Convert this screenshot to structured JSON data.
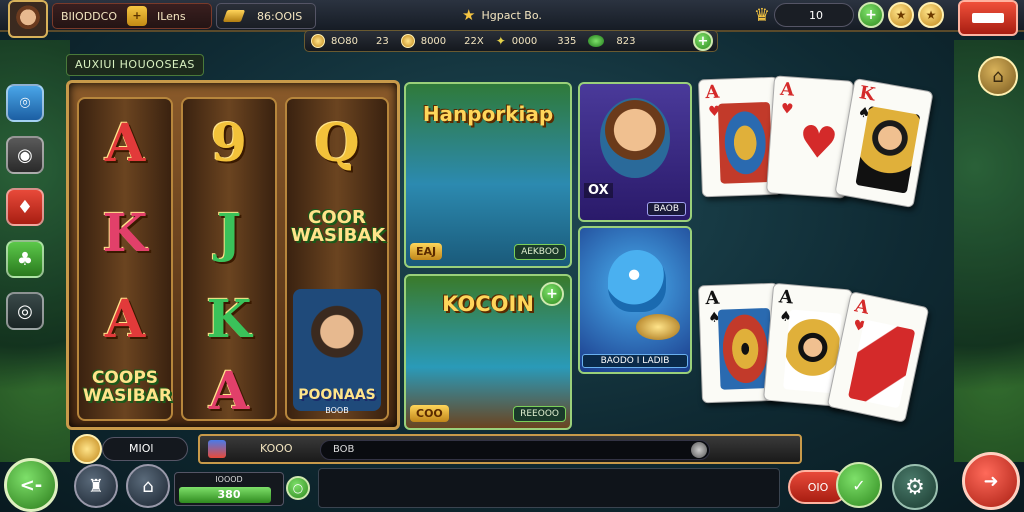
{
  "header": {
    "player_name": "BIIODDCO",
    "plus_label": "+",
    "title_label": "ILens",
    "gold_amount": "86:OOIS",
    "center_title": "Hgpact Bo.",
    "vip_value": "10",
    "plus_right": "+",
    "gold_coin_a": "★",
    "gold_coin_b": "★"
  },
  "statbar": {
    "coins_a": "8O80",
    "coins_a2": "23",
    "coins_b": "8000",
    "coins_b2": "22X",
    "wand_a": "0000",
    "wand_b": "335",
    "gems": "823",
    "plus": "+"
  },
  "sidebar": {
    "items": [
      {
        "icon": "map-pin-icon",
        "glyph": "⌾"
      },
      {
        "icon": "wolf-icon",
        "glyph": "◉"
      },
      {
        "icon": "card-icon",
        "glyph": "♦"
      },
      {
        "icon": "tree-icon",
        "glyph": "♣"
      },
      {
        "icon": "chat-icon",
        "glyph": "◎"
      }
    ]
  },
  "slot": {
    "label": "AUXIUI HOUOOSEAS",
    "reel1": [
      "A",
      "K",
      "A"
    ],
    "reel2": [
      "9",
      "J",
      "K",
      "A"
    ],
    "reel3": [
      "Q"
    ],
    "reel1_badge": "COOPS\nWASIBAR",
    "reel3_badge": "COOR\nWASIBAK",
    "reel3_char_label": "POONAAS",
    "reel3_char_sub": "BOOB"
  },
  "tiles": {
    "t1": {
      "title": "Hanporkiap",
      "tag": "EAJ",
      "button": "AEKBOO"
    },
    "t2": {
      "title": "KOCOIN",
      "tag": "COO",
      "button": "REEOOO",
      "plus": "+"
    },
    "t3": {
      "ox": "OX",
      "button": "BAOB"
    },
    "t4": {
      "button": "BAODO I LADIB"
    }
  },
  "cards": [
    {
      "rank": "A",
      "suit": "♥",
      "color": "red"
    },
    {
      "rank": "A",
      "suit": "♥",
      "color": "red"
    },
    {
      "rank": "K",
      "suit": "♠",
      "color": "red"
    },
    {
      "rank": "A",
      "suit": "♠",
      "color": "black"
    },
    {
      "rank": "A",
      "suit": "♠",
      "color": "black"
    },
    {
      "rank": "A",
      "suit": "♥",
      "color": "red"
    }
  ],
  "bottom": {
    "coin_value": "MIOl",
    "progress_label": "KOOO",
    "progress_track_text": "BOB",
    "xp_label": "IOOOD",
    "xp_value": "380",
    "xp_progress": 0.9,
    "chat_placeholder": "",
    "red_pill": "OIO",
    "back_glyph": "<-",
    "gear_glyph": "⚙",
    "red_big_glyph": "➜",
    "house_glyph": "⌂",
    "green_glyph": "✓",
    "xp_btn_glyph": "○"
  },
  "colors": {
    "accent_gold": "#f5c542",
    "accent_green": "#3ac25a",
    "accent_red": "#e23a3a"
  }
}
